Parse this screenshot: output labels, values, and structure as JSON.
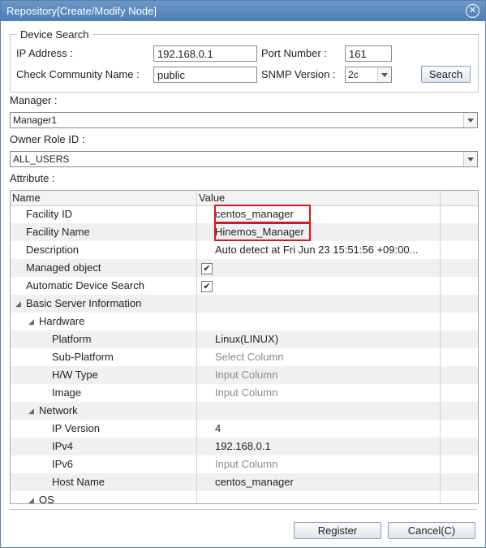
{
  "window": {
    "title": "Repository[Create/Modify Node]",
    "close_glyph": "✕"
  },
  "device_search": {
    "legend": "Device Search",
    "ip_label": "IP Address :",
    "ip_value": "192.168.0.1",
    "port_label": "Port Number :",
    "port_value": "161",
    "community_label": "Check Community Name :",
    "community_value": "public",
    "snmp_label": "SNMP Version :",
    "snmp_value": "2c",
    "search_label": "Search"
  },
  "manager": {
    "label": "Manager :",
    "value": "Manager1"
  },
  "owner_role": {
    "label": "Owner Role ID :",
    "value": "ALL_USERS"
  },
  "attribute": {
    "label": "Attribute :"
  },
  "table": {
    "headers": {
      "name": "Name",
      "value": "Value"
    },
    "rows": [
      {
        "name": "Facility ID",
        "value": "centos_manager"
      },
      {
        "name": "Facility Name",
        "value": "Hinemos_Manager"
      },
      {
        "name": "Description",
        "value": "Auto detect at Fri Jun 23 15:51:56 +09:00..."
      },
      {
        "name": "Managed object",
        "value": "✔"
      },
      {
        "name": "Automatic Device Search",
        "value": "✔"
      },
      {
        "name": "Basic Server Information",
        "value": ""
      },
      {
        "name": "Hardware",
        "value": ""
      },
      {
        "name": "Platform",
        "value": "Linux(LINUX)"
      },
      {
        "name": "Sub-Platform",
        "value": "Select Column"
      },
      {
        "name": "H/W Type",
        "value": "Input Column"
      },
      {
        "name": "Image",
        "value": "Input Column"
      },
      {
        "name": "Network",
        "value": ""
      },
      {
        "name": "IP Version",
        "value": "4"
      },
      {
        "name": "IPv4",
        "value": "192.168.0.1"
      },
      {
        "name": "IPv6",
        "value": "Input Column"
      },
      {
        "name": "Host Name",
        "value": "centos_manager"
      },
      {
        "name": "OS",
        "value": ""
      }
    ]
  },
  "buttons": {
    "register": "Register",
    "cancel": "Cancel(C)"
  },
  "icons": {
    "expand": "◢"
  }
}
